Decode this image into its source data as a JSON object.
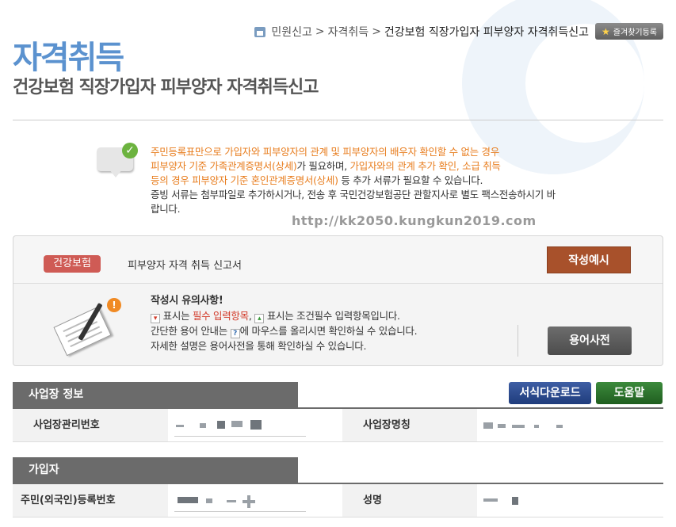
{
  "breadcrumb": {
    "items": [
      "민원신고",
      "자격취득"
    ],
    "current": "건강보험 직장가입자 피부양자 자격취득신고",
    "separator": ">"
  },
  "favorite_button": "즐겨찾기등록",
  "header": {
    "title": "자격취득",
    "subtitle": "건강보험 직장가입자 피부양자 자격취득신고"
  },
  "notice": {
    "line1_hl": "주민등록표만으로 가입자와 피부양자의 관계 및 피부양자의 배우자 확인할 수 없는 경우",
    "line2_hl": "피부양자 기준 가족관계증명서(상세)",
    "line2_rest": "가 필요하며, ",
    "line2_hl2": "가입자와의 관계 추가 확인, 소급 취득",
    "line3_hl": "등의 경우 피부양자 기준 혼인관계증명서(상세)",
    "line3_rest": " 등 추가 서류가 필요할 수 있습니다.",
    "line4": "증빙 서류는 첨부파일로 추가하시거나, 전송 후 국민건강보험공단 관할지사로 별도 팩스전송하시기 바",
    "line5": "랍니다."
  },
  "watermark_url": "http://kk2050.kungkun2019.com",
  "form": {
    "tag": "건강보험",
    "name": "피부양자 자격 취득 신고서",
    "example_button": "작성예시",
    "caution": {
      "heading": "작성시 유의사항!",
      "line1_a": " 표시는 ",
      "line1_required": "필수 입력항목",
      "line1_b": ", ",
      "line1_c": " 표시는 조건필수 입력항목입니다.",
      "line2_a": "간단한 용어 안내는 ",
      "line2_b": "에 마우스를 올리시면 확인하실 수 있습니다.",
      "line3": "자세한 설명은 용어사전을 통해 확인하실 수 있습니다."
    },
    "glossary_button": "용어사전"
  },
  "workplace": {
    "header": "사업장 정보",
    "download_button": "서식다운로드",
    "help_button": "도움말",
    "mgmt_no_label": "사업장관리번호",
    "name_label": "사업장명칭"
  },
  "subscriber": {
    "header": "가입자",
    "rrn_label": "주민(외국인)등록번호",
    "name_label": "성명"
  }
}
